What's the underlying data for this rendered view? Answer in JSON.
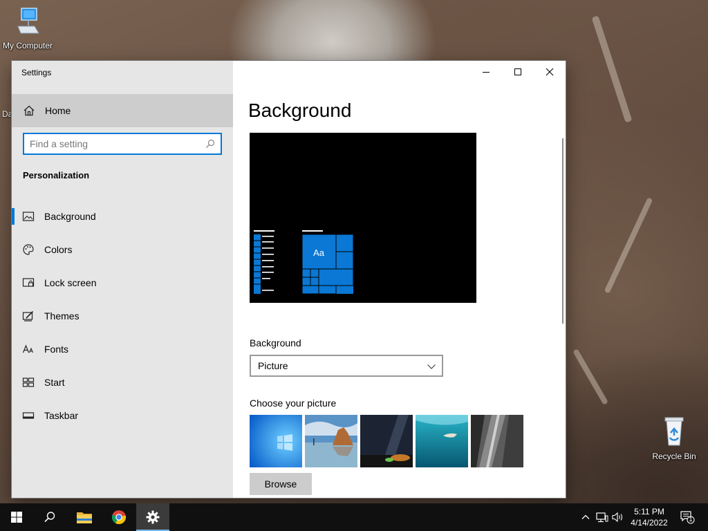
{
  "desktop": {
    "icons": {
      "my_computer": "My Computer",
      "recycle_bin": "Recycle Bin",
      "partial": "Da"
    }
  },
  "window": {
    "title": "Settings",
    "controls": {
      "minimize": "minimize-icon",
      "maximize": "maximize-icon",
      "close": "close-icon"
    }
  },
  "sidebar": {
    "home_label": "Home",
    "search_placeholder": "Find a setting",
    "section_title": "Personalization",
    "items": [
      {
        "label": "Background",
        "icon": "picture-icon",
        "active": true
      },
      {
        "label": "Colors",
        "icon": "palette-icon",
        "active": false
      },
      {
        "label": "Lock screen",
        "icon": "lock-screen-icon",
        "active": false
      },
      {
        "label": "Themes",
        "icon": "themes-icon",
        "active": false
      },
      {
        "label": "Fonts",
        "icon": "fonts-icon",
        "active": false
      },
      {
        "label": "Start",
        "icon": "start-icon",
        "active": false
      },
      {
        "label": "Taskbar",
        "icon": "taskbar-icon",
        "active": false
      }
    ]
  },
  "main": {
    "title": "Background",
    "preview": {
      "tile_text": "Aa"
    },
    "background_label": "Background",
    "background_value": "Picture",
    "choose_label": "Choose your picture",
    "browse_label": "Browse"
  },
  "taskbar": {
    "time": "5:11 PM",
    "date": "4/14/2022",
    "notification_count": "1"
  },
  "colors": {
    "accent": "#0078d7",
    "sidebar_bg": "#e6e6e6",
    "taskbar_bg": "#101010"
  }
}
